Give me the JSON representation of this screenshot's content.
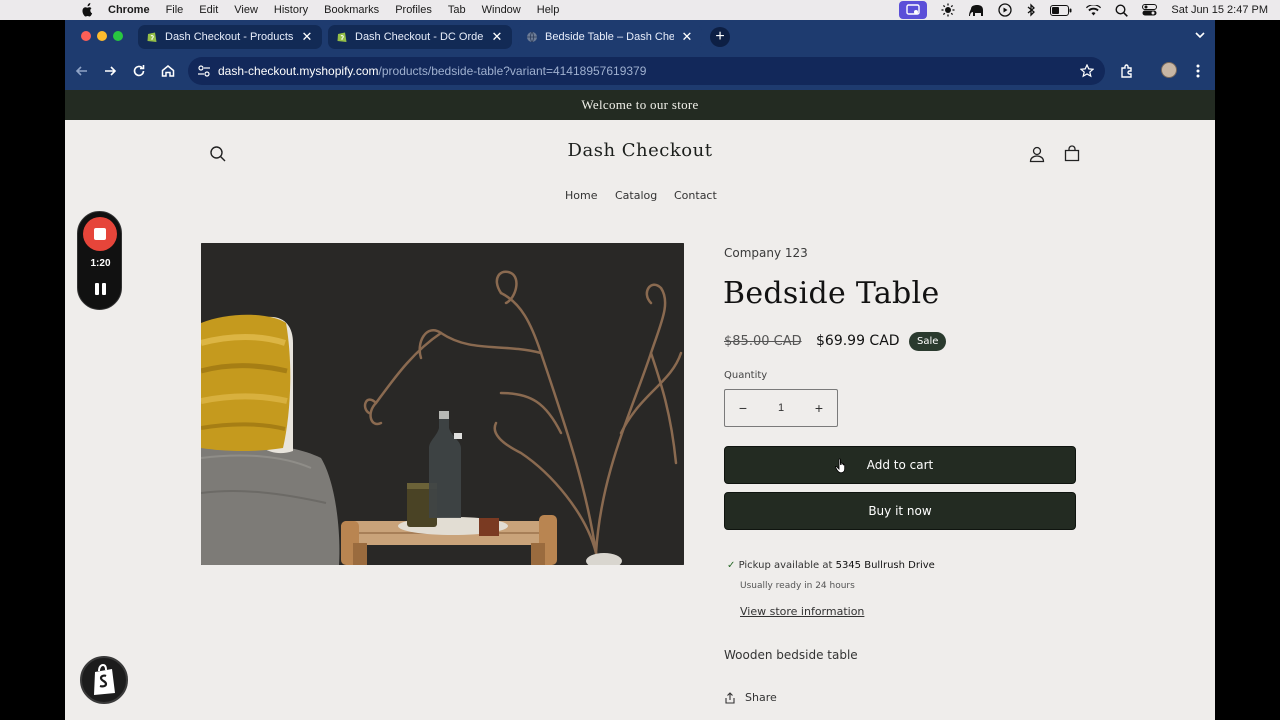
{
  "menubar": {
    "app": "Chrome",
    "items": [
      "File",
      "Edit",
      "View",
      "History",
      "Bookmarks",
      "Profiles",
      "Tab",
      "Window",
      "Help"
    ],
    "clock": "Sat Jun 15  2:47 PM"
  },
  "tabs": [
    {
      "label": "Dash Checkout - Products - B",
      "state": "inactive"
    },
    {
      "label": "Dash Checkout - DC Order Li",
      "state": "inactive"
    },
    {
      "label": "Bedside Table – Dash Checko",
      "state": "active"
    }
  ],
  "toolbar": {
    "url_host": "dash-checkout.myshopify.com",
    "url_path": "/products/bedside-table?variant=41418957619379"
  },
  "announcement": "Welcome to our store",
  "store": {
    "name": "Dash Checkout",
    "nav": [
      "Home",
      "Catalog",
      "Contact"
    ]
  },
  "product": {
    "vendor": "Company 123",
    "title": "Bedside Table",
    "compare_price": "$85.00 CAD",
    "price": "$69.99 CAD",
    "badge": "Sale",
    "quantity_label": "Quantity",
    "quantity": "1",
    "add_to_cart": "Add to cart",
    "buy_now": "Buy it now",
    "pickup_prefix": "Pickup available at",
    "pickup_location": "5345 Bullrush Drive",
    "pickup_ready": "Usually ready in 24 hours",
    "store_info_link": "View store information",
    "description": "Wooden bedside table",
    "share": "Share"
  },
  "recorder": {
    "time": "1:20"
  },
  "colors": {
    "brand_dark": "#232b22",
    "chrome_blue": "#1e3b6f",
    "page_bg": "#efedeb",
    "record_red": "#e6453a"
  }
}
